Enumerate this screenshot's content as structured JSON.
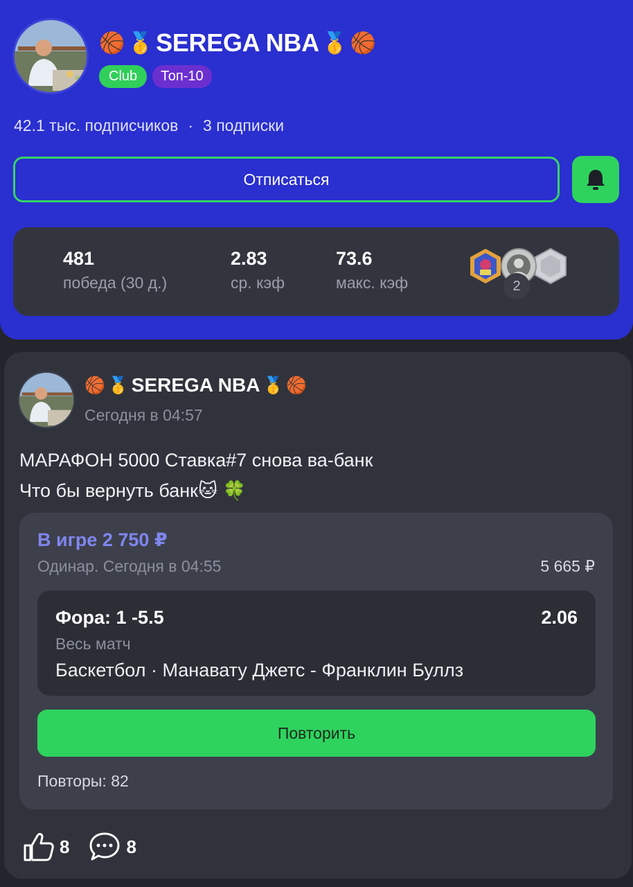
{
  "profile": {
    "name": "SEREGA NBA",
    "badges": [
      "Club",
      "Топ-10"
    ],
    "subscribers": "42.1 тыс. подписчиков",
    "separator": "·",
    "subscriptions": "3 подписки",
    "unsubscribe_label": "Отписаться",
    "bell_icon": "bell-icon",
    "stats": [
      {
        "value": "481",
        "label": "победа (30 д.)"
      },
      {
        "value": "2.83",
        "label": "ср. кэф"
      },
      {
        "value": "73.6",
        "label": "макс. кэф"
      }
    ],
    "medals_extra": "2",
    "emoji": {
      "ball": "🏀",
      "medal": "🥇"
    }
  },
  "post": {
    "author": "SEREGA NBA",
    "time": "Сегодня в 04:57",
    "text_line1": "МАРАФОН 5000 Ставка#7 снова  ва-банк",
    "text_line2": "Что бы вернуть банк🐱 🍀",
    "bet": {
      "status": "В игре 2 750 ₽",
      "type": "Одинар. Сегодня в 04:55",
      "potential_win": "5 665 ₽",
      "market": "Фора: 1 -5.5",
      "odds": "2.06",
      "period": "Весь матч",
      "event": "Баскетбол · Манавату Джетс - Франклин Буллз",
      "repeat_label": "Повторить",
      "repeats": "Повторы: 82"
    },
    "likes": "8",
    "comments": "8"
  },
  "colors": {
    "header_bg": "#2a2fcf",
    "accent_green": "#2ed35e",
    "bet_status": "#7f86ee",
    "card_bg": "#31333c"
  }
}
